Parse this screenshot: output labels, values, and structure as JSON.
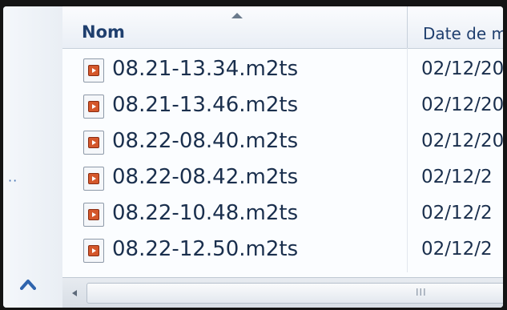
{
  "columns": {
    "name": "Nom",
    "date": "Date de m"
  },
  "files": [
    {
      "name": "08.21-13.34.m2ts",
      "date": "02/12/20"
    },
    {
      "name": "08.21-13.46.m2ts",
      "date": "02/12/20"
    },
    {
      "name": "08.22-08.40.m2ts",
      "date": "02/12/20"
    },
    {
      "name": "08.22-08.42.m2ts",
      "date": "02/12/2"
    },
    {
      "name": "08.22-10.48.m2ts",
      "date": "02/12/2"
    },
    {
      "name": "08.22-12.50.m2ts",
      "date": "02/12/2"
    }
  ],
  "nav": {
    "dots": "··"
  },
  "scrollbar": {
    "grip": "III"
  },
  "colors": {
    "text": "#1a2f4d",
    "header_text": "#1f3f6e",
    "icon": "#d4572b",
    "accent": "#3f6fb0"
  },
  "icons": {
    "file": "video-file-icon",
    "sort": "sort-ascending-icon",
    "nav_up": "chevron-up-icon",
    "scroll_left": "scroll-left-arrow-icon"
  }
}
